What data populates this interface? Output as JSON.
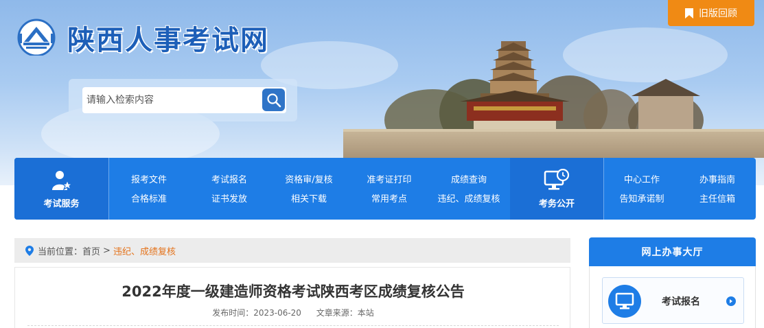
{
  "header": {
    "site_title": "陕西人事考试网",
    "old_version_label": "旧版回顾",
    "search_placeholder": "请输入检索内容"
  },
  "nav": {
    "section_exam_service": "考试服务",
    "section_exam_public": "考务公开",
    "links": [
      "报考文件",
      "考试报名",
      "资格审/复核",
      "准考证打印",
      "成绩查询",
      "合格标准",
      "证书发放",
      "相关下载",
      "常用考点",
      "违纪、成绩复核",
      "中心工作",
      "办事指南",
      "告知承诺制",
      "主任信箱"
    ]
  },
  "breadcrumb": {
    "prefix": "当前位置：",
    "home": "首页",
    "separator": ">",
    "current": "违纪、成绩复核"
  },
  "article": {
    "title": "2022年度一级建造师资格考试陕西考区成绩复核公告",
    "publish_time": "发布时间：2023-06-20",
    "source": "文章来源：本站"
  },
  "sidebar": {
    "header": "网上办事大厅",
    "card_label": "考试报名"
  },
  "colors": {
    "nav_blue": "#1e7de6",
    "nav_dark_blue": "#1b6fd6",
    "title_blue": "#1d5fb8",
    "orange": "#f08a14",
    "breadcrumb_current": "#e4731c"
  },
  "icons": [
    "logo-emblem-icon",
    "bookmark-icon",
    "search-icon",
    "person-star-icon",
    "monitor-clock-icon",
    "location-pin-icon",
    "monitor-icon",
    "arrow-right-icon"
  ]
}
